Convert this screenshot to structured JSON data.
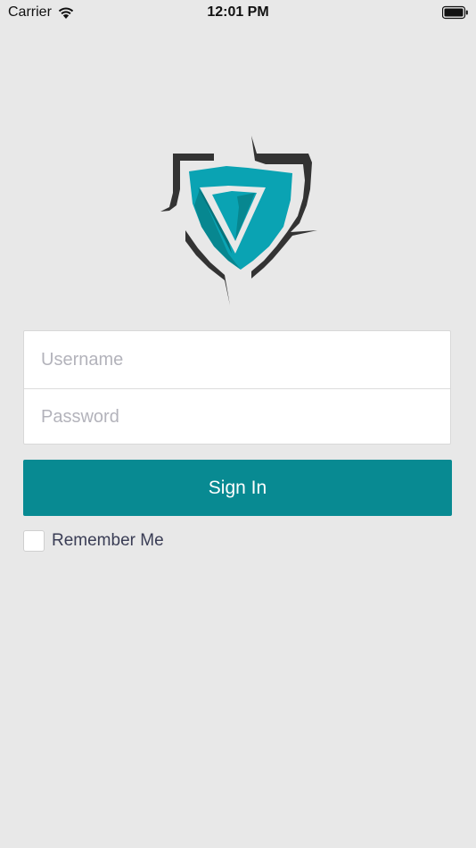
{
  "status_bar": {
    "carrier": "Carrier",
    "time": "12:01 PM",
    "wifi_icon": "wifi-icon",
    "battery_icon": "battery-icon"
  },
  "logo": {
    "icon": "shield-logo-icon",
    "colors": {
      "teal": "#0aa3b3",
      "dark_teal": "#088a92",
      "outline": "#333333"
    }
  },
  "form": {
    "username_placeholder": "Username",
    "password_placeholder": "Password",
    "username_value": "",
    "password_value": ""
  },
  "sign_in": {
    "label": "Sign In",
    "color": "#088a92"
  },
  "remember_me": {
    "label": "Remember Me",
    "checked": false
  }
}
